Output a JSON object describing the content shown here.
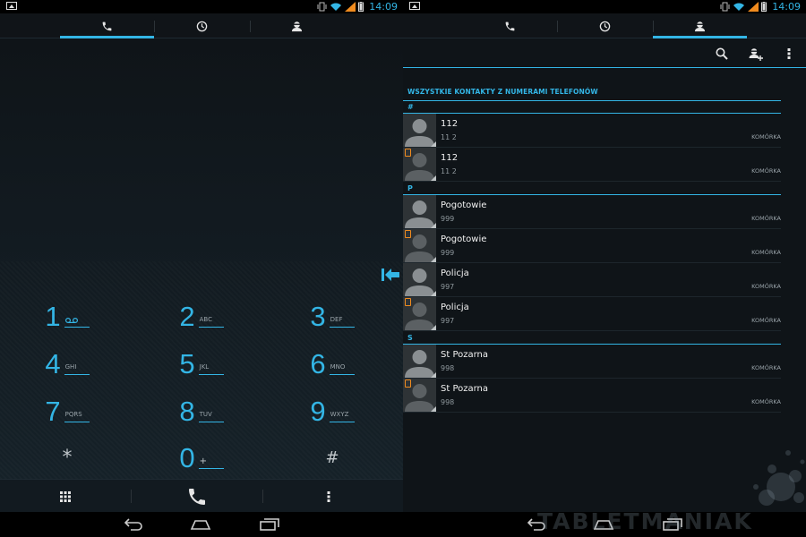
{
  "status": {
    "time": "14:09"
  },
  "tabs": [
    {
      "name": "phone-tab",
      "icon": "phone-icon"
    },
    {
      "name": "recent-tab",
      "icon": "clock-icon"
    },
    {
      "name": "contacts-tab",
      "icon": "person-icon"
    }
  ],
  "accent_color": "#33b5e5",
  "dialpad": {
    "keys": [
      {
        "digit": "1",
        "letters": ""
      },
      {
        "digit": "2",
        "letters": "ABC"
      },
      {
        "digit": "3",
        "letters": "DEF"
      },
      {
        "digit": "4",
        "letters": "GHI"
      },
      {
        "digit": "5",
        "letters": "JKL"
      },
      {
        "digit": "6",
        "letters": "MNO"
      },
      {
        "digit": "7",
        "letters": "PQRS"
      },
      {
        "digit": "8",
        "letters": "TUV"
      },
      {
        "digit": "9",
        "letters": "WXYZ"
      },
      {
        "digit": "*",
        "letters": ""
      },
      {
        "digit": "0",
        "letters": "+"
      },
      {
        "digit": "#",
        "letters": ""
      }
    ]
  },
  "contacts": {
    "header": "WSZYSTKIE KONTAKTY Z NUMERAMI TELEFONÓW",
    "sections": [
      {
        "letter": "#",
        "items": [
          {
            "name": "112",
            "number": "11 2",
            "type": "KOMÓRKA",
            "sim": false
          },
          {
            "name": "112",
            "number": "11 2",
            "type": "KOMÓRKA",
            "sim": true
          }
        ]
      },
      {
        "letter": "P",
        "items": [
          {
            "name": "Pogotowie",
            "number": "999",
            "type": "KOMÓRKA",
            "sim": false
          },
          {
            "name": "Pogotowie",
            "number": "999",
            "type": "KOMÓRKA",
            "sim": true
          },
          {
            "name": "Policja",
            "number": "997",
            "type": "KOMÓRKA",
            "sim": false
          },
          {
            "name": "Policja",
            "number": "997",
            "type": "KOMÓRKA",
            "sim": true
          }
        ]
      },
      {
        "letter": "S",
        "items": [
          {
            "name": "St Pozarna",
            "number": "998",
            "type": "KOMÓRKA",
            "sim": false
          },
          {
            "name": "St Pozarna",
            "number": "998",
            "type": "KOMÓRKA",
            "sim": true
          }
        ]
      }
    ]
  },
  "watermark": "TABLETMANIAK"
}
